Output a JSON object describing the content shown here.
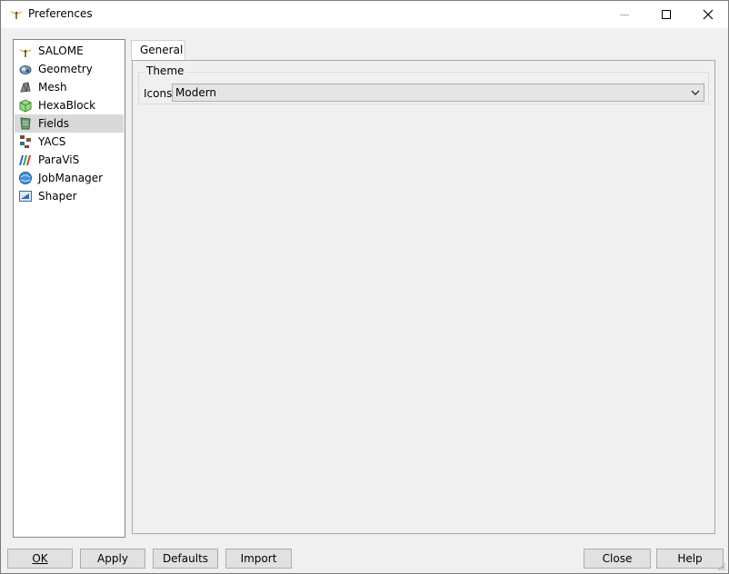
{
  "window": {
    "title": "Preferences"
  },
  "sidebar": {
    "items": [
      {
        "label": "SALOME",
        "icon": "salome-icon"
      },
      {
        "label": "Geometry",
        "icon": "geometry-icon"
      },
      {
        "label": "Mesh",
        "icon": "mesh-icon"
      },
      {
        "label": "HexaBlock",
        "icon": "hexablock-icon"
      },
      {
        "label": "Fields",
        "icon": "fields-icon",
        "selected": true
      },
      {
        "label": "YACS",
        "icon": "yacs-icon"
      },
      {
        "label": "ParaViS",
        "icon": "paravis-icon"
      },
      {
        "label": "JobManager",
        "icon": "jobmanager-icon"
      },
      {
        "label": "Shaper",
        "icon": "shaper-icon"
      }
    ]
  },
  "tabs": [
    {
      "label": "General",
      "active": true
    }
  ],
  "theme": {
    "group_title": "Theme",
    "icons_label": "Icons",
    "icons_value": "Modern"
  },
  "buttons": {
    "ok": "OK",
    "apply": "Apply",
    "defaults": "Defaults",
    "import": "Import",
    "close": "Close",
    "help": "Help"
  },
  "colors": {
    "background": "#f0f0f0",
    "selection": "#d9d9d9"
  }
}
